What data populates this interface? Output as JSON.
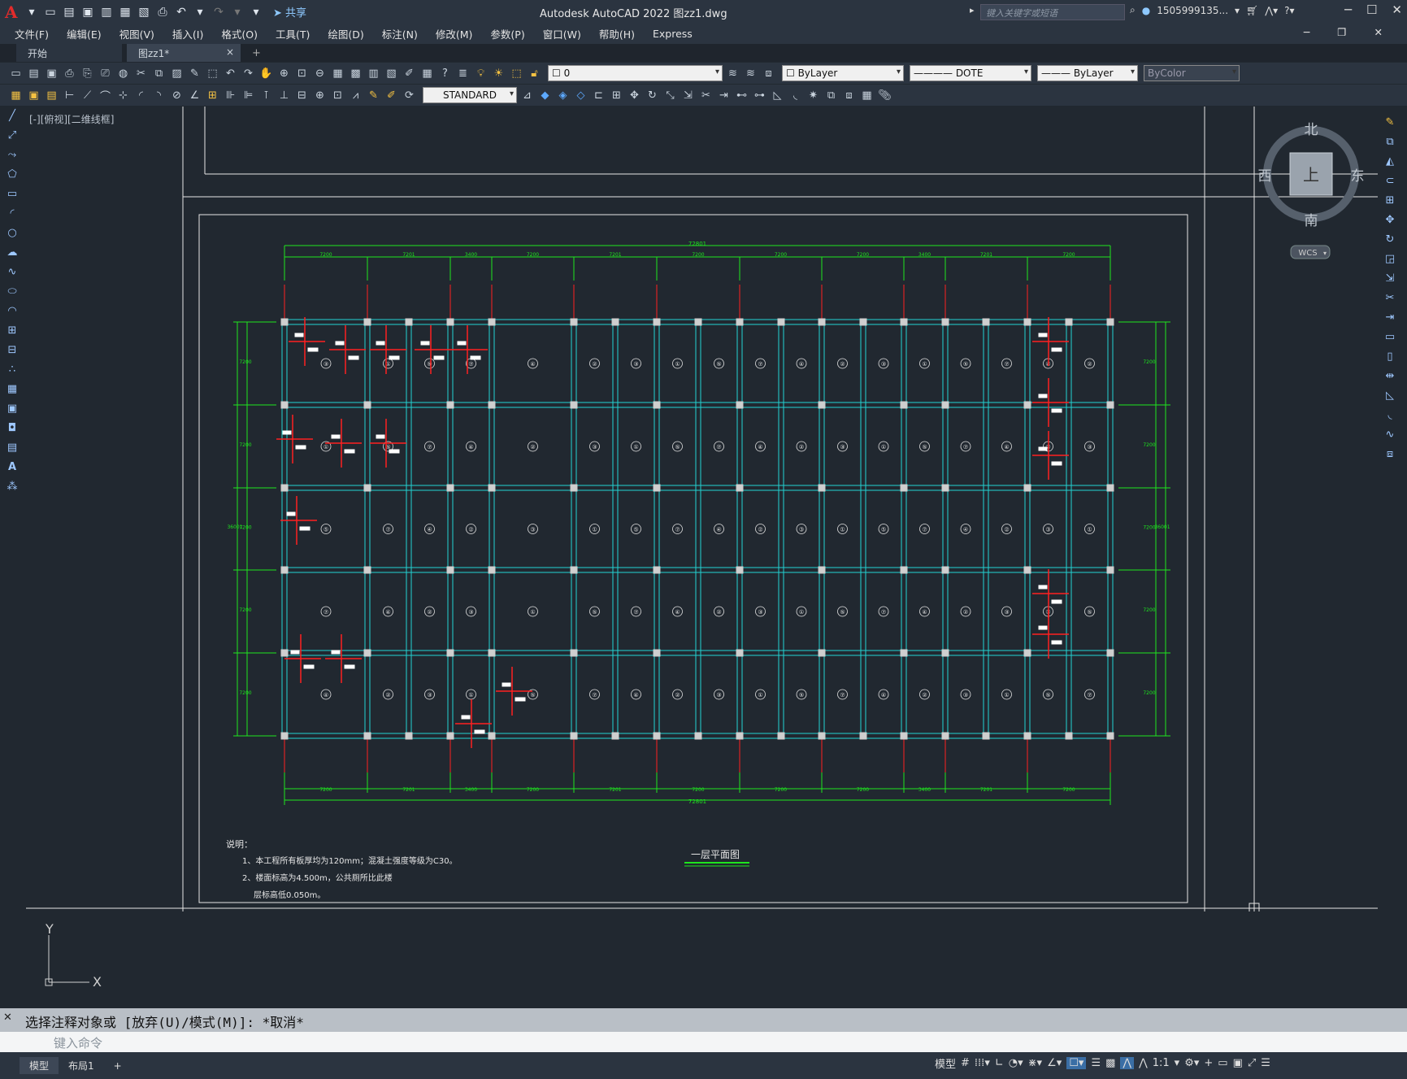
{
  "titlebar": {
    "title": "Autodesk AutoCAD 2022    图zz1.dwg",
    "share": "共享",
    "search_placeholder": "键入关键字或短语",
    "user": "1505999135...",
    "app_logo": "A"
  },
  "menu": [
    "文件(F)",
    "编辑(E)",
    "视图(V)",
    "插入(I)",
    "格式(O)",
    "工具(T)",
    "绘图(D)",
    "标注(N)",
    "修改(M)",
    "参数(P)",
    "窗口(W)",
    "帮助(H)",
    "Express"
  ],
  "tabs": {
    "start": "开始",
    "doc": "图zz1*",
    "close": "×",
    "add": "+"
  },
  "toolbar": {
    "layer": "0",
    "color": "ByLayer",
    "linetype": "———— DOTE",
    "lineweight": "——— ByLayer",
    "plotstyle": "ByColor",
    "textstyle": "STANDARD"
  },
  "viewport": {
    "label": "[-][俯视][二维线框]"
  },
  "ucs": {
    "y": "Y",
    "x": "X"
  },
  "viewcube": {
    "north": "北",
    "south": "南",
    "east": "东",
    "west": "西",
    "face": "上",
    "wcs": "WCS"
  },
  "drawing": {
    "title": "一层平面图",
    "total_dim": "72801",
    "top_dims": [
      "7200",
      "7201",
      "3400",
      "7200",
      "7201",
      "7200",
      "7200",
      "7200",
      "3400",
      "7201",
      "7200"
    ],
    "bottom_dims": [
      "7200",
      "7201",
      "3400",
      "7200",
      "7201",
      "7200",
      "7200",
      "7200",
      "3400",
      "7201",
      "7200"
    ],
    "side_total": "36001",
    "side_dims": [
      "7200",
      "7200",
      "7200",
      "7200",
      "7200"
    ],
    "notes_title": "说明：",
    "notes": [
      "1、本工程所有板厚均为120mm；混凝土强度等级为C30。",
      "2、楼面标高为4.500m，公共厕所比此楼",
      "层标高低0.050m。"
    ]
  },
  "command": {
    "history": "选择注释对象或 [放弃(U)/模式(M)]: *取消*",
    "placeholder": "键入命令"
  },
  "statusbar": {
    "model_tab": "模型",
    "layout_tab": "布局1",
    "add": "+",
    "model": "模型",
    "scale": "1:1"
  }
}
